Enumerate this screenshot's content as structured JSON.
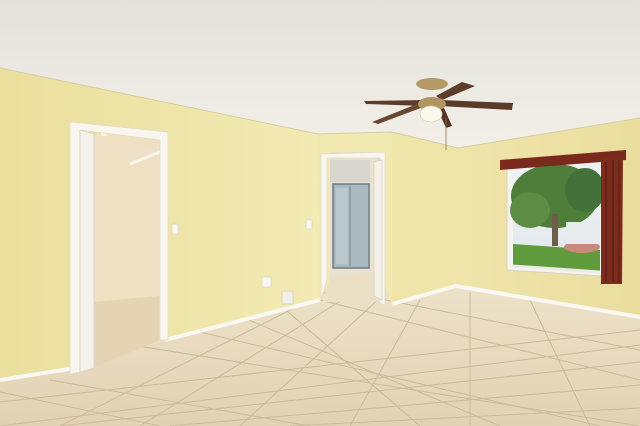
{
  "scene": {
    "subject": "empty-bedroom-interior",
    "palette": {
      "ceiling": "#ece9e1",
      "wall_left": "#efe6a8",
      "wall_back": "#f3eab2",
      "wall_right": "#efe3a6",
      "floor": "#e6d8bd",
      "grout": "#c9b99a",
      "trim": "#f7f5ee",
      "curtain": "#7a2a1c",
      "fan_blade": "#5a3a28",
      "fan_brass": "#b49a66",
      "window_sky": "#e8eef2",
      "lawn": "#5e9a3c",
      "tree": "#4f7d3a",
      "closet_wall": "#efe0c8",
      "glass": "#aebfc8"
    },
    "objects": [
      "ceiling-fan",
      "closet-doorway",
      "hallway-doorway",
      "window",
      "curtain",
      "tile-floor",
      "wall-outlet",
      "light-switch",
      "floor-vent"
    ]
  }
}
